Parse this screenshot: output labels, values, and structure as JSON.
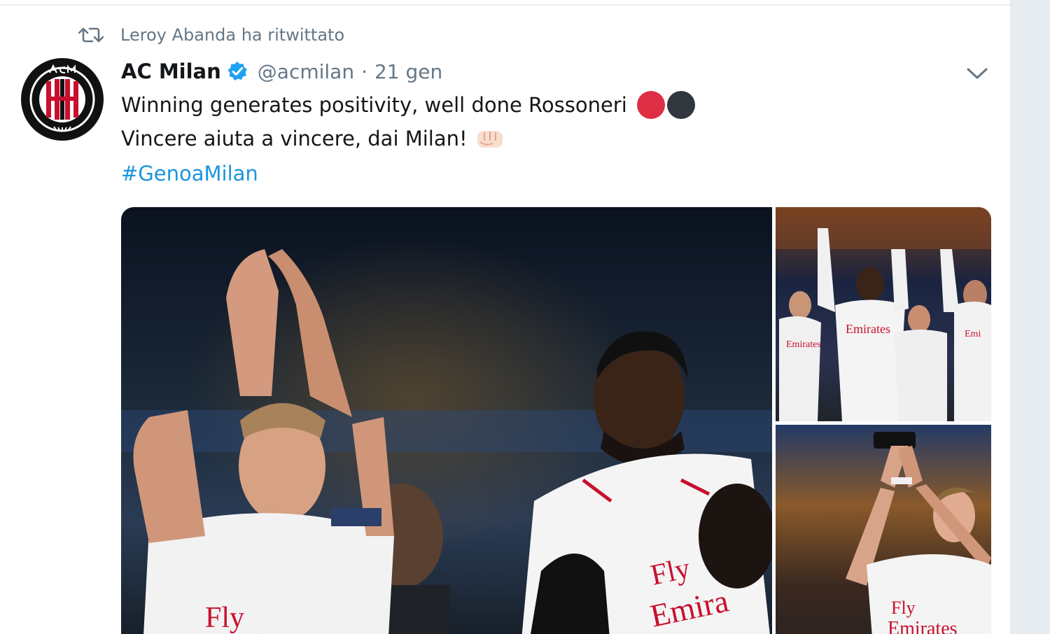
{
  "retweet": {
    "text": "Leroy Abanda ha ritwittato",
    "icon": "retweet-icon"
  },
  "tweet": {
    "display_name": "AC Milan",
    "verified": true,
    "handle": "@acmilan",
    "separator": "·",
    "time": "21 gen",
    "lines": [
      "Winning generates positivity, well done Rossoneri",
      "Vincere aiuta a vincere, dai Milan!"
    ],
    "hashtag": "#GenoaMilan",
    "emojis": [
      "red-circle-emoji",
      "black-circle-emoji",
      "oncoming-fist-emoji"
    ]
  },
  "media": {
    "photos": [
      "photo-players-applauding",
      "photo-players-waving",
      "photo-player-clapping"
    ]
  },
  "colors": {
    "link": "#1b95e0",
    "secondary_text": "#657786",
    "primary_text": "#14171a",
    "verified_blue": "#1da1f2",
    "milan_red": "#dd2e44"
  }
}
